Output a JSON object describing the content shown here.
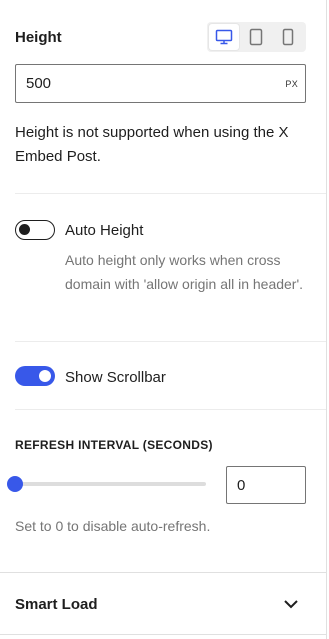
{
  "height": {
    "label": "Height",
    "devices": [
      {
        "name": "desktop",
        "icon": "desktop-icon",
        "active": true
      },
      {
        "name": "tablet",
        "icon": "tablet-icon",
        "active": false
      },
      {
        "name": "mobile",
        "icon": "mobile-icon",
        "active": false
      }
    ],
    "value": "500",
    "unit": "PX",
    "note": "Height is not supported when using the X Embed Post."
  },
  "auto_height": {
    "label": "Auto Height",
    "enabled": false,
    "help": "Auto height only works when cross domain with 'allow origin all in header'."
  },
  "show_scrollbar": {
    "label": "Show Scrollbar",
    "enabled": true
  },
  "refresh_interval": {
    "title": "REFRESH INTERVAL (SECONDS)",
    "value": "0",
    "slider_fraction": 0,
    "help": "Set to 0 to disable auto-refresh."
  },
  "smart_load": {
    "title": "Smart Load",
    "expanded": false,
    "icon": "chevron-down-icon"
  },
  "colors": {
    "accent": "#3858e9",
    "text": "#1e1e1e",
    "muted": "#757575"
  }
}
